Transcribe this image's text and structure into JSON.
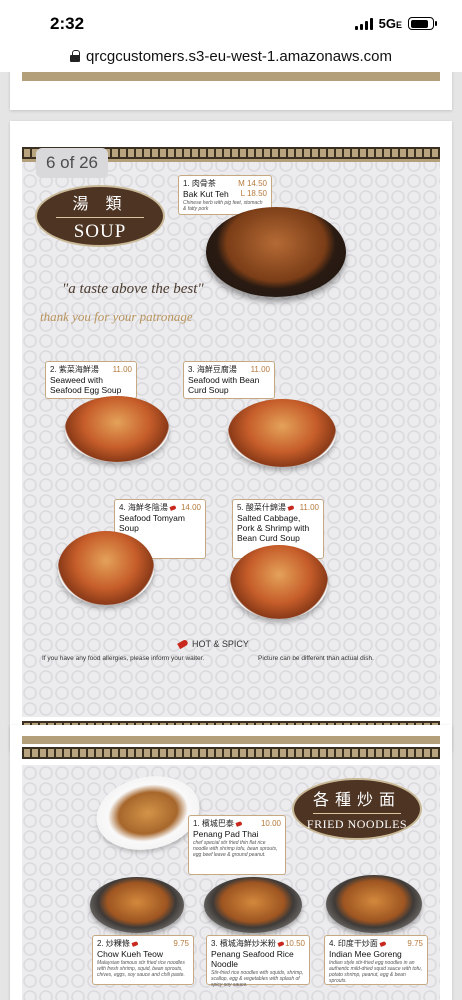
{
  "status_bar": {
    "time": "2:32",
    "network": "5G",
    "network_suffix": "E",
    "battery_percent": 82
  },
  "browser": {
    "url": "qrcgcustomers.s3-eu-west-1.amazonaws.com"
  },
  "viewer": {
    "page_indicator": "6 of 26"
  },
  "soup_page": {
    "section_cn": "湯 類",
    "section_en": "SOUP",
    "tagline": "\"a taste above the best\"",
    "thanks": "thank you for your patronage",
    "items": [
      {
        "number_cn": "1. 肉骨茶",
        "name": "Bak Kut Teh",
        "prices": [
          "M  14.50",
          "L  18.50"
        ],
        "desc": "Chinese herb with pig feet, stomach & fatty pork",
        "spicy": false
      },
      {
        "number_cn": "2. 紫菜海鮮湯",
        "price": "11.00",
        "name": "Seaweed with Seafood Egg Soup",
        "spicy": false
      },
      {
        "number_cn": "3. 海鮮豆腐湯",
        "price": "11.00",
        "name": "Seafood with Bean Curd Soup",
        "spicy": false
      },
      {
        "number_cn": "4. 海鮮冬陰湯",
        "price": "14.00",
        "name": "Seafood Tomyam Soup",
        "spicy": true
      },
      {
        "number_cn": "5. 酸菜什錦湯",
        "price": "11.00",
        "name": "Salted Cabbage, Pork & Shrimp with Bean Curd Soup",
        "spicy": true
      }
    ],
    "legend_label": "HOT & SPICY",
    "allergy_note": "If you have any food allergies, please inform your waiter.",
    "picture_note": "Picture can be different than actual dish."
  },
  "noodle_page": {
    "section_cn": "各種炒面",
    "section_en": "FRIED NOODLES",
    "items": [
      {
        "number_cn": "1. 檳城巴泰",
        "price": "10.00",
        "name": "Penang Pad Thai",
        "desc": "chef special stir fried thin flat rice noodle with shrimp tofu, bean sprouts, egg beef leave & ground peanut.",
        "spicy": true
      },
      {
        "number_cn": "2. 炒粿條",
        "price": "9.75",
        "name": "Chow Kueh Teow",
        "desc": "Malaysian famous stir fried rice noodles with fresh shrimp, squid, bean sprouts, chives, eggs, soy sauce and chili paste.",
        "spicy": true
      },
      {
        "number_cn": "3. 檳城海鮮炒米粉",
        "price": "10.50",
        "name": "Penang Seafood Rice Noodle",
        "desc": "Stir-fried rice noodles with squids, shrimp, scallop, egg & vegetables with splash of spicy soy sauce.",
        "spicy": true
      },
      {
        "number_cn": "4. 印度干炒面",
        "price": "9.75",
        "name": "Indian Mee Goreng",
        "desc": "Indian style stir-fried egg noodles in an authentic mild-dried squid sauce with tofu, potato shrimp, peanut, egg & bean sprouts.",
        "spicy": true
      }
    ]
  }
}
